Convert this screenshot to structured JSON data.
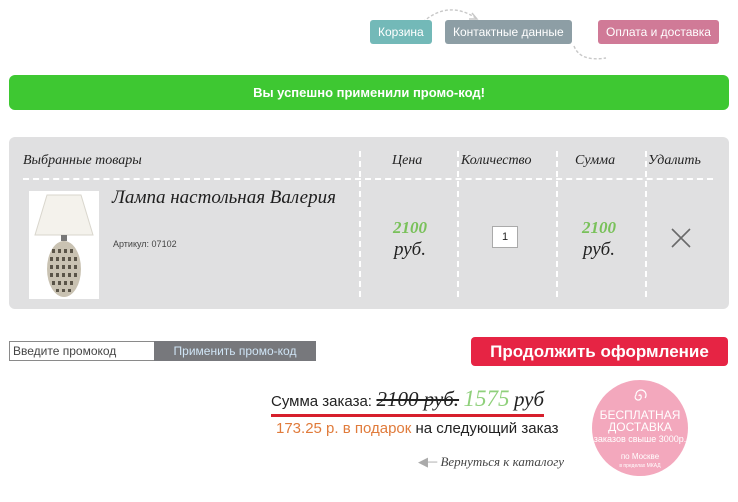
{
  "steps": [
    {
      "label": "Корзина",
      "color": "#73b9b8"
    },
    {
      "label": "Контактные данные",
      "color": "#8d9ea5"
    },
    {
      "label": "Оплата и доставка",
      "color": "#d07a97"
    }
  ],
  "banner": {
    "text": "Вы успешно применили промо-код!"
  },
  "cart": {
    "headers": {
      "products": "Выбранные товары",
      "price": "Цена",
      "quantity": "Количество",
      "total": "Сумма",
      "delete": "Удалить"
    },
    "item": {
      "name": "Лампа настольная Валерия",
      "sku": "Артикул: 07102",
      "price": "2100",
      "price_currency": "руб.",
      "quantity": "1",
      "total": "2100",
      "total_currency": "руб.",
      "delete_icon": "close-icon"
    }
  },
  "promo": {
    "placeholder": "Введите промокод",
    "apply_label": "Применить промо-код"
  },
  "continue_label": "Продолжить оформление",
  "summary": {
    "label": "Сумма заказа:",
    "old_amount": "2100 руб.",
    "new_amount": "1575",
    "currency": "руб",
    "gift_amount": "173.25 р. в подарок",
    "gift_rest": "на следующий заказ"
  },
  "back_link": "Вернуться к каталогу",
  "free_delivery": {
    "title": "БЕСПЛАТНАЯ ДОСТАВКА",
    "condition": "заказов свыше 3000р.",
    "area": "по Москве",
    "note": "в пределах МКАД"
  },
  "colors": {
    "success": "#3ec832",
    "accent_red": "#e62444",
    "price_green": "#79c15a",
    "gift_orange": "#e07b3b",
    "badge_pink": "#f3a8bd"
  }
}
